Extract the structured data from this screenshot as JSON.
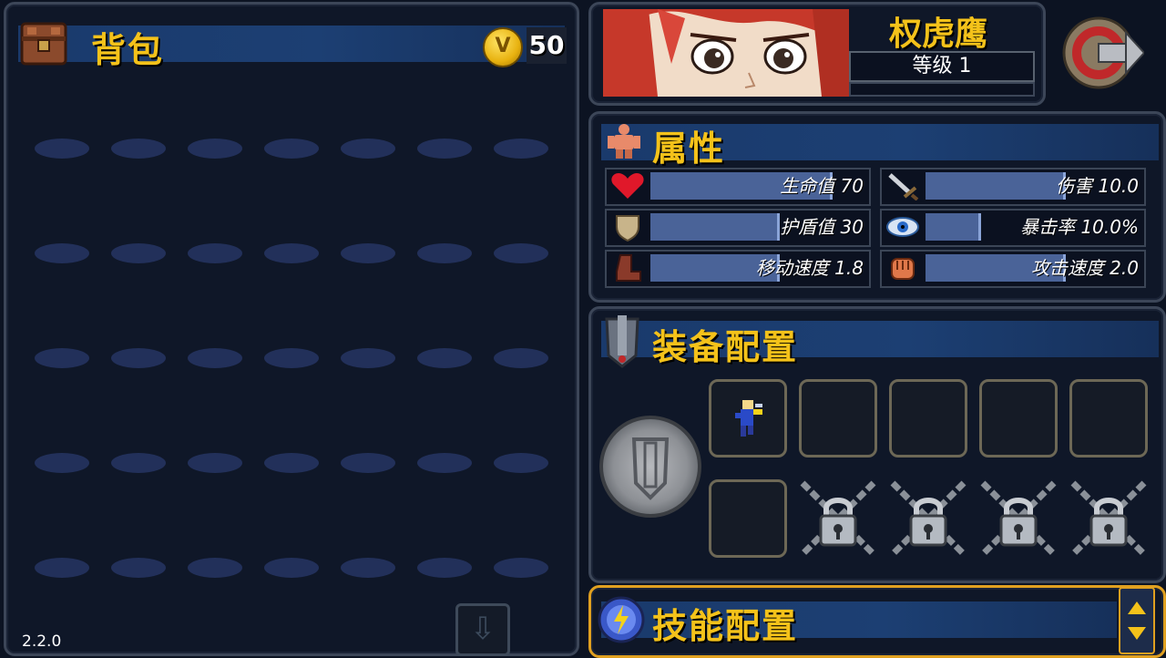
{
  "backpack": {
    "title": "背包",
    "gold": "50",
    "coin_symbol": "V",
    "version": "2.2.0",
    "grid_rows": 5,
    "grid_cols": 7
  },
  "character": {
    "name": "权虎鹰",
    "level": "等级 1"
  },
  "attributes": {
    "title": "属性",
    "stats": [
      {
        "label": "生命值 70",
        "icon": "heart-icon",
        "fill": 0.85
      },
      {
        "label": "伤害 10.0",
        "icon": "sword-icon",
        "fill": 0.65
      },
      {
        "label": "护盾值 30",
        "icon": "shield-icon",
        "fill": 0.6
      },
      {
        "label": "暴击率 10.0%",
        "icon": "eye-icon",
        "fill": 0.25
      },
      {
        "label": "移动速度 1.8",
        "icon": "boot-icon",
        "fill": 0.6
      },
      {
        "label": "攻击速度 2.0",
        "icon": "fist-icon",
        "fill": 0.65
      }
    ]
  },
  "equipment": {
    "title": "装备配置",
    "slots_row1": [
      "filled",
      "empty",
      "empty",
      "empty",
      "empty"
    ],
    "slots_row2": [
      "empty",
      "locked",
      "locked",
      "locked",
      "locked"
    ]
  },
  "skills": {
    "title": "技能配置"
  },
  "colors": {
    "title_gold": "#f4c21a",
    "banner_blue": "#1c3f73",
    "stat_bar": "#4a6398",
    "skill_border": "#e0a020"
  }
}
